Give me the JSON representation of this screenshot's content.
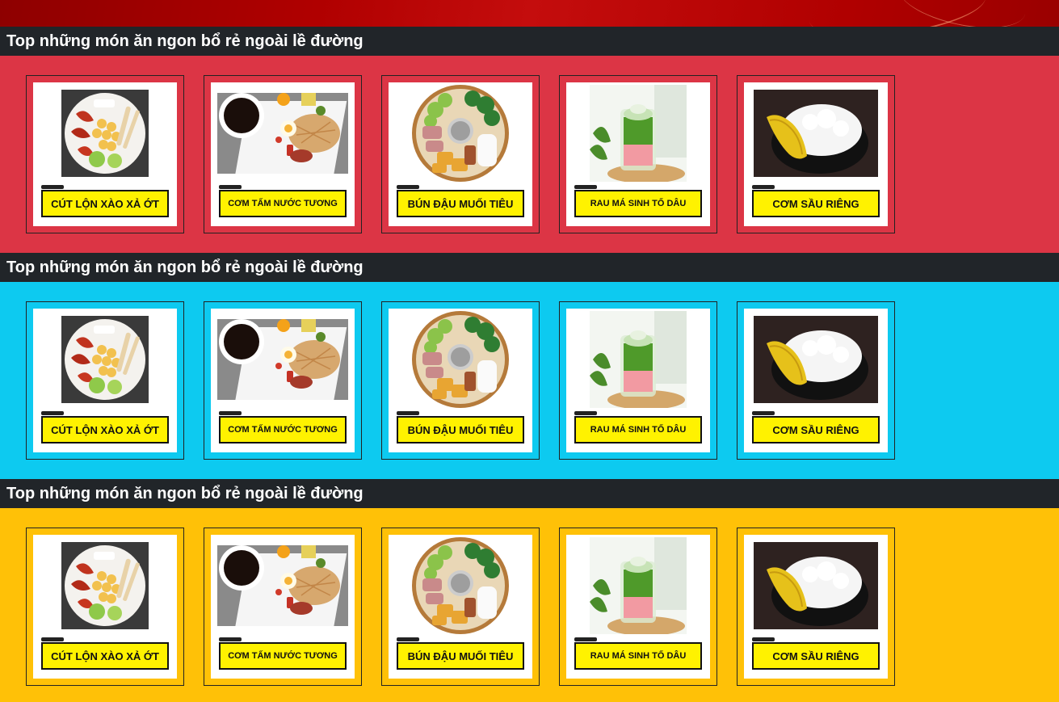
{
  "colors": {
    "banner": "#b00000",
    "header_bg": "#212529",
    "card_border": "#222222",
    "label_bg": "#fff200"
  },
  "sections": [
    {
      "title": "Top những món ăn ngon bổ rẻ ngoài lề đường",
      "bg": "#dc3545",
      "items": [
        {
          "label": "CÚT LỘN XÀO XẢ ỚT",
          "image": "quail-egg-stirfry-image"
        },
        {
          "label": "CƠM TẤM NƯỚC TƯƠNG",
          "image": "broken-rice-image"
        },
        {
          "label": "BÚN ĐẬU MUỐI TIÊU",
          "image": "tofu-noodle-platter-image"
        },
        {
          "label": "RAU MÁ SINH TỐ DÂU",
          "image": "pennywort-smoothie-image"
        },
        {
          "label": "CƠM SẦU RIÊNG",
          "image": "durian-rice-image"
        }
      ]
    },
    {
      "title": "Top những món ăn ngon bổ rẻ ngoài lề đường",
      "bg": "#0dcaf0",
      "items": [
        {
          "label": "CÚT LỘN XÀO XẢ ỚT",
          "image": "quail-egg-stirfry-image"
        },
        {
          "label": "CƠM TẤM NƯỚC TƯƠNG",
          "image": "broken-rice-image"
        },
        {
          "label": "BÚN ĐẬU MUỐI TIÊU",
          "image": "tofu-noodle-platter-image"
        },
        {
          "label": "RAU MÁ SINH TỐ DÂU",
          "image": "pennywort-smoothie-image"
        },
        {
          "label": "CƠM SẦU RIÊNG",
          "image": "durian-rice-image"
        }
      ]
    },
    {
      "title": "Top những món ăn ngon bổ rẻ ngoài lề đường",
      "bg": "#ffc107",
      "items": [
        {
          "label": "CÚT LỘN XÀO XẢ ỚT",
          "image": "quail-egg-stirfry-image"
        },
        {
          "label": "CƠM TẤM NƯỚC TƯƠNG",
          "image": "broken-rice-image"
        },
        {
          "label": "BÚN ĐẬU MUỐI TIÊU",
          "image": "tofu-noodle-platter-image"
        },
        {
          "label": "RAU MÁ SINH TỐ DÂU",
          "image": "pennywort-smoothie-image"
        },
        {
          "label": "CƠM SẦU RIÊNG",
          "image": "durian-rice-image"
        }
      ]
    }
  ]
}
